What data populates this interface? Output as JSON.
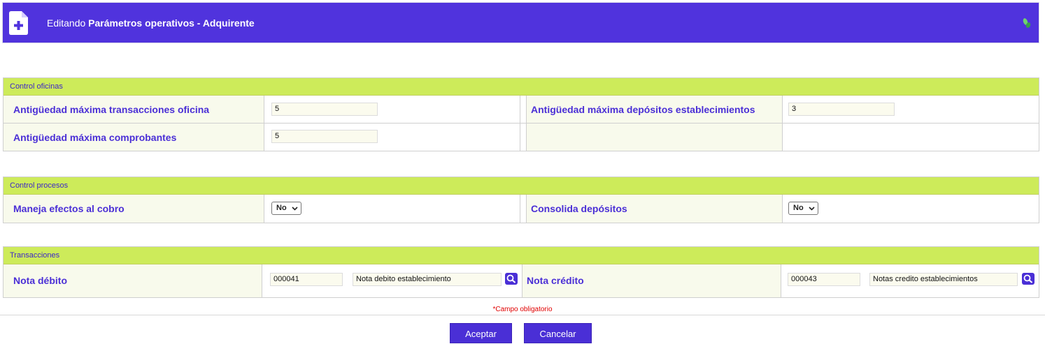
{
  "header": {
    "prefix": "Editando",
    "title": "Parámetros operativos - Adquirente"
  },
  "sections": {
    "oficinas": {
      "title": "Control oficinas",
      "row1": {
        "left_label": "Antigüedad máxima transacciones oficina",
        "left_value": "5",
        "right_label": "Antigüedad máxima depósitos establecimientos",
        "right_value": "3"
      },
      "row2": {
        "left_label": "Antigüedad máxima comprobantes",
        "left_value": "5"
      }
    },
    "procesos": {
      "title": "Control procesos",
      "left_label": "Maneja efectos al cobro",
      "left_value": "No",
      "right_label": "Consolida depósitos",
      "right_value": "No"
    },
    "transacciones": {
      "title": "Transacciones",
      "left_label": "Nota débito",
      "left_code": "000041",
      "left_desc": "Nota debito establecimiento",
      "right_label": "Nota crédito",
      "right_code": "000043",
      "right_desc": "Notas credito establecimientos"
    }
  },
  "required_note": "*Campo obligatorio",
  "buttons": {
    "accept": "Aceptar",
    "cancel": "Cancelar"
  },
  "colors": {
    "header_bg": "#5033dd",
    "section_bg": "#cdeb5a",
    "accent": "#4a2fd6",
    "required": "#e00000"
  }
}
